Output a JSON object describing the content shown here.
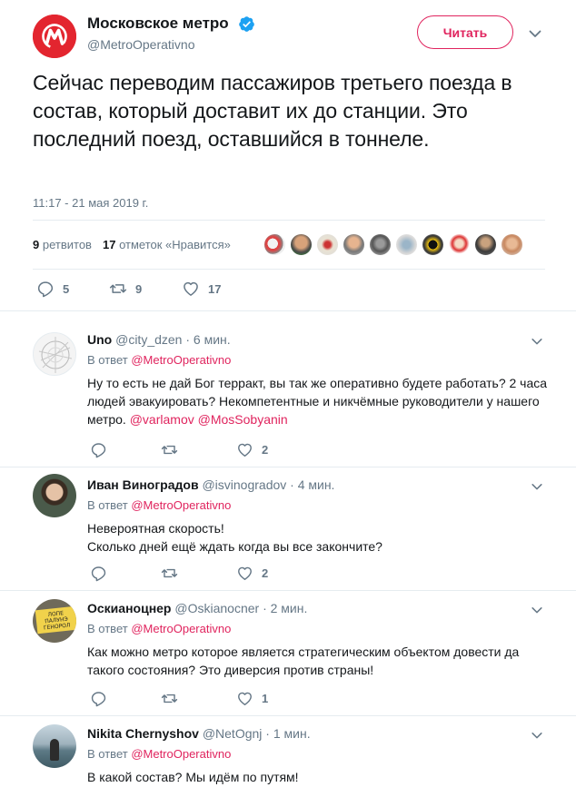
{
  "tweet": {
    "author_name": "Московское метро",
    "author_handle": "@MetroOperativno",
    "follow_label": "Читать",
    "text": "Сейчас переводим пассажиров третьего поезда в состав, который доставит их до станции. Это последний поезд, оставшийся в тоннеле.",
    "timestamp": "11:17 - 21 мая 2019 г.",
    "retweets_count": "9",
    "retweets_label": "ретвитов",
    "likes_count": "17",
    "likes_label": "отметок «Нравится»",
    "actions": {
      "replies": "5",
      "retweets": "9",
      "likes": "17"
    }
  },
  "colors": {
    "accent": "#e0245e",
    "brand": "#e3252f",
    "muted": "#657786",
    "verified": "#1da1f2"
  },
  "replies": [
    {
      "name": "Uno",
      "handle": "@city_dzen",
      "time": "· 6 мин.",
      "reply_prefix": "В ответ ",
      "reply_to": "@MetroOperativno",
      "text": "Ну то есть не дай Бог терракт, вы так же оперативно будете работать? 2 часа людей эвакуировать? Некомпетентные и никчёмные руководители у нашего метро. ",
      "mentions": [
        "@varlamov",
        "@MosSobyanin"
      ],
      "replies_count": "",
      "retweets_count": "",
      "likes_count": "2"
    },
    {
      "name": "Иван Виноградов",
      "handle": "@isvinogradov",
      "time": "· 4 мин.",
      "reply_prefix": "В ответ ",
      "reply_to": "@MetroOperativno",
      "text_line1": "Невероятная скорость!",
      "text_line2": "Сколько дней ещё ждать когда вы все закончите?",
      "replies_count": "",
      "retweets_count": "",
      "likes_count": "2"
    },
    {
      "name": "Оскианоцнер",
      "handle": "@Oskianocner",
      "time": "· 2 мин.",
      "reply_prefix": "В ответ ",
      "reply_to": "@MetroOperativno",
      "text": "Как можно метро которое является стратегическим объектом довести да такого состояния? Это диверсия против страны!",
      "avatar_sign_line1": "ЛОПЕ",
      "avatar_sign_line2": "ПАЛУНЭ",
      "avatar_sign_line3": "ГЕНОРОЛ",
      "replies_count": "",
      "retweets_count": "",
      "likes_count": "1"
    },
    {
      "name": "Nikita Chernyshov",
      "handle": "@NetOgnj",
      "time": "· 1 мин.",
      "reply_prefix": "В ответ ",
      "reply_to": "@MetroOperativno",
      "text": "В какой состав? Мы идём по путям!"
    }
  ],
  "icons": {
    "reply": "reply-icon",
    "retweet": "retweet-icon",
    "like": "heart-icon",
    "more": "chevron-down-icon",
    "verified": "verified-badge-icon"
  }
}
